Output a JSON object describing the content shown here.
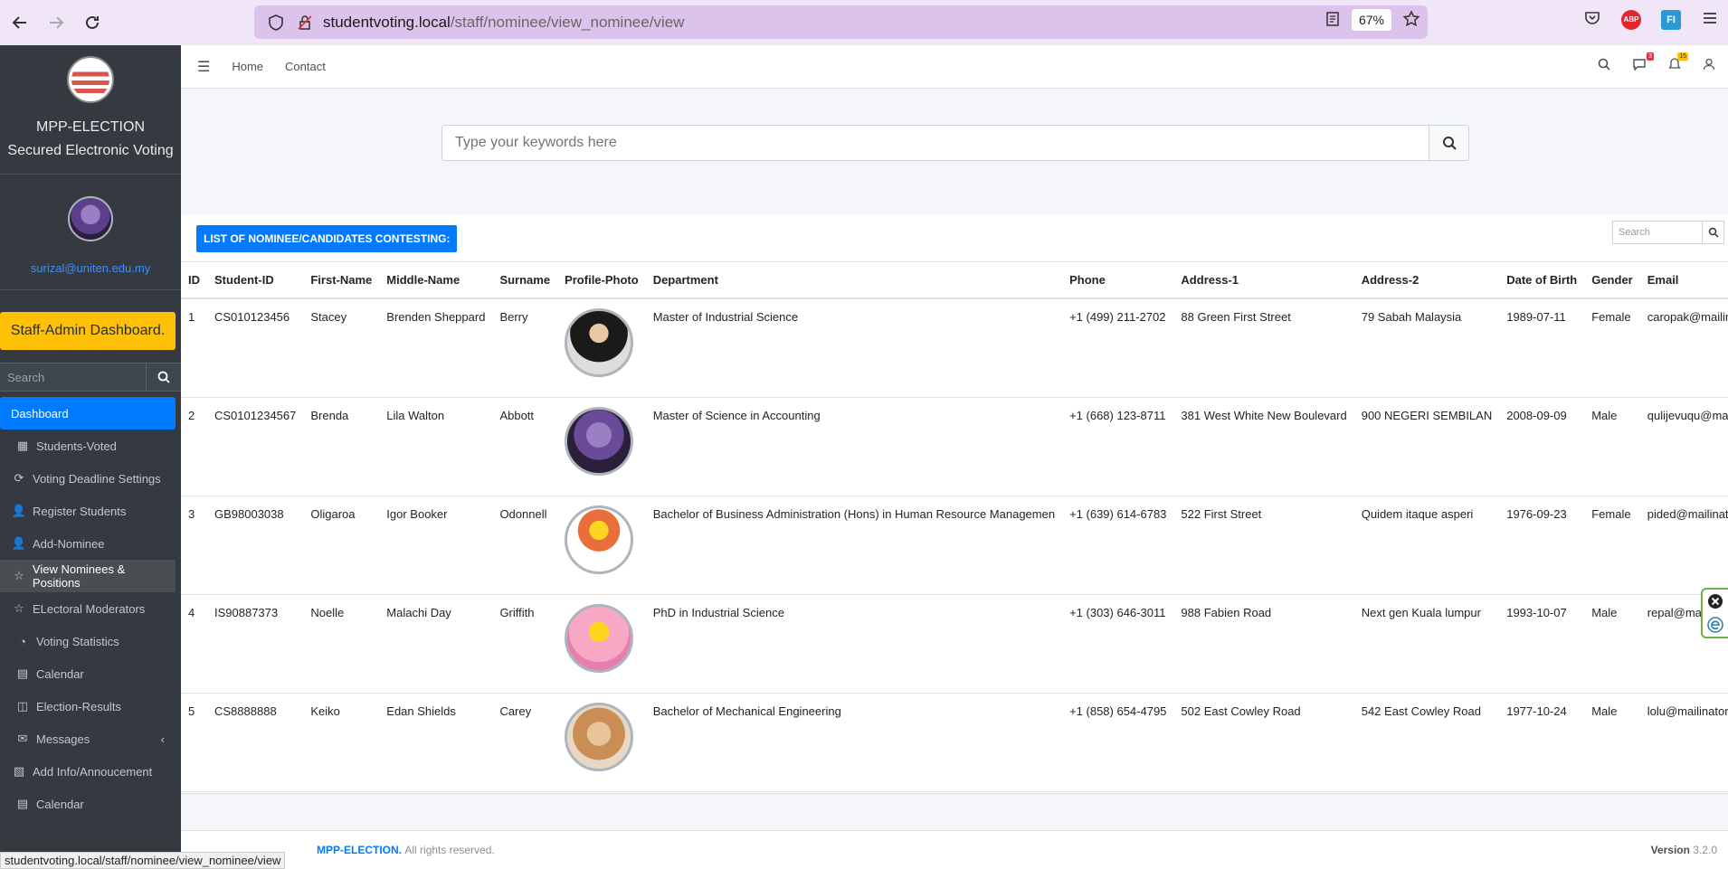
{
  "browser": {
    "url_host": "studentvoting.local",
    "url_path": "/staff/nominee/view_nominee/view",
    "zoom": "67%"
  },
  "sidebar": {
    "brand_line1": "MPP-ELECTION",
    "brand_line2": "Secured Electronic Voting",
    "user_email": "surizal@uniten.edu.my",
    "admin_button": "Staff-Admin Dashboard.",
    "search_placeholder": "Search",
    "items": [
      {
        "label": "Dashboard",
        "icon": "none"
      },
      {
        "label": "Students-Voted",
        "icon": "grid-icon"
      },
      {
        "label": "Voting Deadline Settings",
        "icon": "refresh-icon"
      },
      {
        "label": "Register Students",
        "icon": "user-plus-icon"
      },
      {
        "label": "Add-Nominee",
        "icon": "user-plus-icon"
      },
      {
        "label": "View Nominees & Positions",
        "icon": "star-icon"
      },
      {
        "label": "ELectoral Moderators",
        "icon": "star-icon"
      },
      {
        "label": "Voting Statistics",
        "icon": "pie-chart-icon"
      },
      {
        "label": "Calendar",
        "icon": "calendar-icon"
      },
      {
        "label": "Election-Results",
        "icon": "columns-icon"
      },
      {
        "label": "Messages",
        "icon": "envelope-icon"
      },
      {
        "label": "Add Info/Annoucement",
        "icon": "rss-icon"
      },
      {
        "label": "Calendar",
        "icon": "calendar-icon"
      }
    ]
  },
  "topnav": {
    "home": "Home",
    "contact": "Contact",
    "messages_count": "3",
    "notifications_count": "15"
  },
  "main_search": {
    "placeholder": "Type your keywords here"
  },
  "card": {
    "title": "LIST OF NOMINEE/CANDIDATES CONTESTING:",
    "search_placeholder": "Search",
    "columns": [
      "ID",
      "Student-ID",
      "First-Name",
      "Middle-Name",
      "Surname",
      "Profile-Photo",
      "Department",
      "Phone",
      "Address-1",
      "Address-2",
      "Date of Birth",
      "Gender",
      "Email"
    ],
    "rows": [
      {
        "id": "1",
        "student_id": "CS010123456",
        "first": "Stacey",
        "middle": "Brenden Sheppard",
        "surname": "Berry",
        "department": "Master of Industrial Science",
        "phone": "+1 (499) 211-2702",
        "address1": "88 Green First Street",
        "address2": "79 Sabah Malaysia",
        "dob": "1989-07-11",
        "gender": "Female",
        "email": "caropak@mailinator.c"
      },
      {
        "id": "2",
        "student_id": "CS0101234567",
        "first": "Brenda",
        "middle": "Lila Walton",
        "surname": "Abbott",
        "department": "Master of Science in Accounting",
        "phone": "+1 (668) 123-8711",
        "address1": "381 West White New Boulevard",
        "address2": "900 NEGERI SEMBILAN",
        "dob": "2008-09-09",
        "gender": "Male",
        "email": "qulijevuqu@mailinato"
      },
      {
        "id": "3",
        "student_id": "GB98003038",
        "first": "Oligaroa",
        "middle": "Igor Booker",
        "surname": "Odonnell",
        "department": "Bachelor of Business Administration (Hons) in Human Resource Managemen",
        "phone": "+1 (639) 614-6783",
        "address1": "522 First Street",
        "address2": "Quidem itaque asperi",
        "dob": "1976-09-23",
        "gender": "Female",
        "email": "pided@mailinator.cor"
      },
      {
        "id": "4",
        "student_id": "IS90887373",
        "first": "Noelle",
        "middle": "Malachi Day",
        "surname": "Griffith",
        "department": "PhD in Industrial Science",
        "phone": "+1 (303) 646-3011",
        "address1": "988 Fabien Road",
        "address2": "Next gen Kuala lumpur",
        "dob": "1993-10-07",
        "gender": "Male",
        "email": "repal@mailinato"
      },
      {
        "id": "5",
        "student_id": "CS8888888",
        "first": "Keiko",
        "middle": "Edan Shields",
        "surname": "Carey",
        "department": "Bachelor of Mechanical Engineering",
        "phone": "+1 (858) 654-4795",
        "address1": "502 East Cowley Road",
        "address2": "542 East Cowley Road",
        "dob": "1977-10-24",
        "gender": "Male",
        "email": "lolu@mailinator.com"
      }
    ]
  },
  "footer": {
    "brand": "MPP-ELECTION.",
    "rights": "All rights reserved.",
    "version_label": "Version",
    "version": "3.2.0"
  },
  "status_url": "studentvoting.local/staff/nominee/view_nominee/view"
}
